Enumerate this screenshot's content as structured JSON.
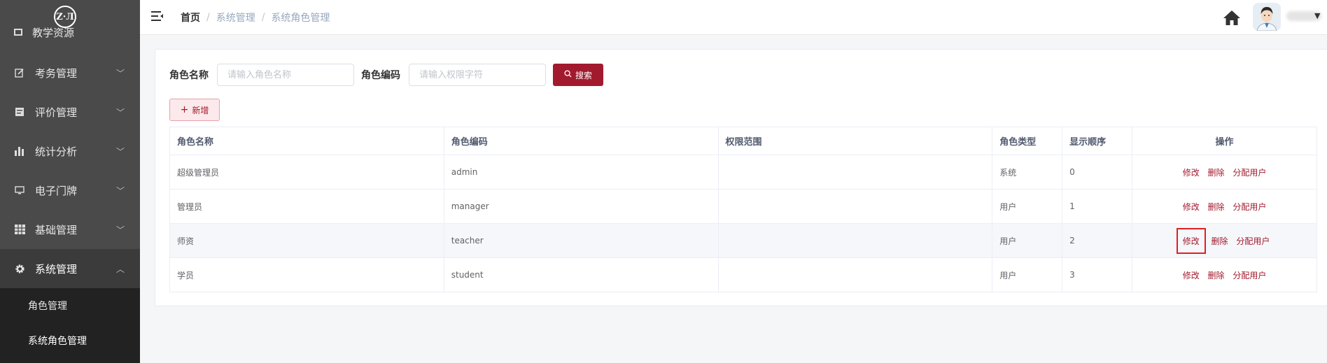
{
  "sidebar": {
    "logo": "Z·Л",
    "partial_item": "教学资源",
    "items": [
      {
        "label": "考务管理",
        "icon": "edit-icon"
      },
      {
        "label": "评价管理",
        "icon": "evaluate-icon"
      },
      {
        "label": "统计分析",
        "icon": "bar-chart-icon"
      },
      {
        "label": "电子门牌",
        "icon": "monitor-icon"
      },
      {
        "label": "基础管理",
        "icon": "grid-icon"
      },
      {
        "label": "系统管理",
        "icon": "gear-icon"
      }
    ],
    "submenu": [
      {
        "label": "角色管理"
      },
      {
        "label": "系统角色管理"
      }
    ]
  },
  "header": {
    "breadcrumb": [
      "首页",
      "系统管理",
      "系统角色管理"
    ],
    "separator": "/"
  },
  "search": {
    "name_label": "角色名称",
    "name_placeholder": "请输入角色名称",
    "code_label": "角色编码",
    "code_placeholder": "请输入权限字符",
    "search_button": "搜索"
  },
  "toolbar": {
    "add_button": "新增"
  },
  "table": {
    "columns": [
      "角色名称",
      "角色编码",
      "权限范围",
      "角色类型",
      "显示顺序",
      "操作"
    ],
    "rows": [
      {
        "name": "超级管理员",
        "code": "admin",
        "scope": "",
        "type": "系统",
        "order": "0"
      },
      {
        "name": "管理员",
        "code": "manager",
        "scope": "",
        "type": "用户",
        "order": "1"
      },
      {
        "name": "师资",
        "code": "teacher",
        "scope": "",
        "type": "用户",
        "order": "2"
      },
      {
        "name": "学员",
        "code": "student",
        "scope": "",
        "type": "用户",
        "order": "3"
      }
    ],
    "actions": {
      "edit": "修改",
      "delete": "删除",
      "assign": "分配用户"
    }
  },
  "colors": {
    "sidebar_bg": "#4a4a4a",
    "submenu_bg": "#222222",
    "brand": "#a21a2d",
    "highlight_box": "#e02020"
  }
}
